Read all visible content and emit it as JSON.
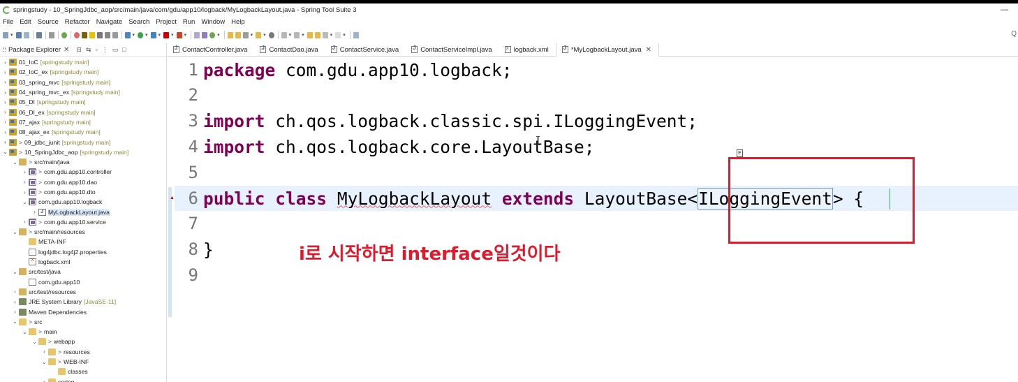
{
  "window": {
    "title": "springstudy - 10_SpringJdbc_aop/src/main/java/com/gdu/app10/logback/MyLogbackLayout.java - Spring Tool Suite 3",
    "minimize": "—"
  },
  "menu": [
    "File",
    "Edit",
    "Source",
    "Refactor",
    "Navigate",
    "Search",
    "Project",
    "Run",
    "Window",
    "Help"
  ],
  "package_explorer": {
    "title": "Package Explorer",
    "items": [
      {
        "label": "01_IoC",
        "decoration": "[springstudy main]"
      },
      {
        "label": "02_IoC_ex",
        "decoration": "[springstudy main]"
      },
      {
        "label": "03_spring_mvc",
        "decoration": "[springstudy main]"
      },
      {
        "label": "04_spring_mvc_ex",
        "decoration": "[springstudy main]"
      },
      {
        "label": "05_DI",
        "decoration": "[springstudy main]"
      },
      {
        "label": "06_DI_ex",
        "decoration": "[springstudy main]"
      },
      {
        "label": "07_ajax",
        "decoration": "[springstudy main]"
      },
      {
        "label": "08_ajax_ex",
        "decoration": "[springstudy main]"
      },
      {
        "label": "09_jdbc_junit",
        "decoration": "[springstudy main]"
      },
      {
        "label": "10_SpringJdbc_aop",
        "decoration": "[springstudy main]"
      },
      {
        "label": "src/main/java",
        "decoration": ""
      },
      {
        "label": "com.gdu.app10.controller",
        "decoration": ""
      },
      {
        "label": "com.gdu.app10.dao",
        "decoration": ""
      },
      {
        "label": "com.gdu.app10.dto",
        "decoration": ""
      },
      {
        "label": "com.gdu.app10.logback",
        "decoration": ""
      },
      {
        "label": "MyLogbackLayout.java",
        "decoration": ""
      },
      {
        "label": "com.gdu.app10.service",
        "decoration": ""
      },
      {
        "label": "src/main/resources",
        "decoration": ""
      },
      {
        "label": "META-INF",
        "decoration": ""
      },
      {
        "label": "log4jdbc.log4j2.properties",
        "decoration": ""
      },
      {
        "label": "logback.xml",
        "decoration": ""
      },
      {
        "label": "src/test/java",
        "decoration": ""
      },
      {
        "label": "com.gdu.app10",
        "decoration": ""
      },
      {
        "label": "src/test/resources",
        "decoration": ""
      },
      {
        "label": "JRE System Library",
        "decoration": "[JavaSE-11]"
      },
      {
        "label": "Maven Dependencies",
        "decoration": ""
      },
      {
        "label": "src",
        "decoration": ""
      },
      {
        "label": "main",
        "decoration": ""
      },
      {
        "label": "webapp",
        "decoration": ""
      },
      {
        "label": "resources",
        "decoration": ""
      },
      {
        "label": "WEB-INF",
        "decoration": ""
      },
      {
        "label": "classes",
        "decoration": ""
      },
      {
        "label": "spring",
        "decoration": ""
      }
    ]
  },
  "editor_tabs": [
    {
      "label": "ContactController.java"
    },
    {
      "label": "ContactDao.java"
    },
    {
      "label": "ContactService.java"
    },
    {
      "label": "ContactServiceImpl.java"
    },
    {
      "label": "logback.xml"
    },
    {
      "label": "*MyLogbackLayout.java"
    }
  ],
  "code": {
    "line_numbers": [
      "1",
      "2",
      "3",
      "4",
      "5",
      "6",
      "7",
      "8",
      "9"
    ],
    "l1_kw": "package",
    "l1_rest": " com.gdu.app10.logback;",
    "l3_kw": "import",
    "l3_rest": " ch.qos.logback.classic.spi.ILoggingEvent;",
    "l4_kw": "import",
    "l4_rest": " ch.qos.logback.core.LayoutBase;",
    "l6_kw1": "public",
    "l6_kw2": "class",
    "l6_name": "MyLogbackLayout",
    "l6_kw3": "extends",
    "l6_base": "LayoutBase<",
    "l6_type": "ILoggingEvent",
    "l6_end": "> {",
    "l8": "}"
  },
  "annotation": "i로 시작하면 interface일것이다",
  "colors": {
    "keyword": "#7f0055",
    "annotation": "#e0192b",
    "current_line": "#e8f2fe"
  }
}
